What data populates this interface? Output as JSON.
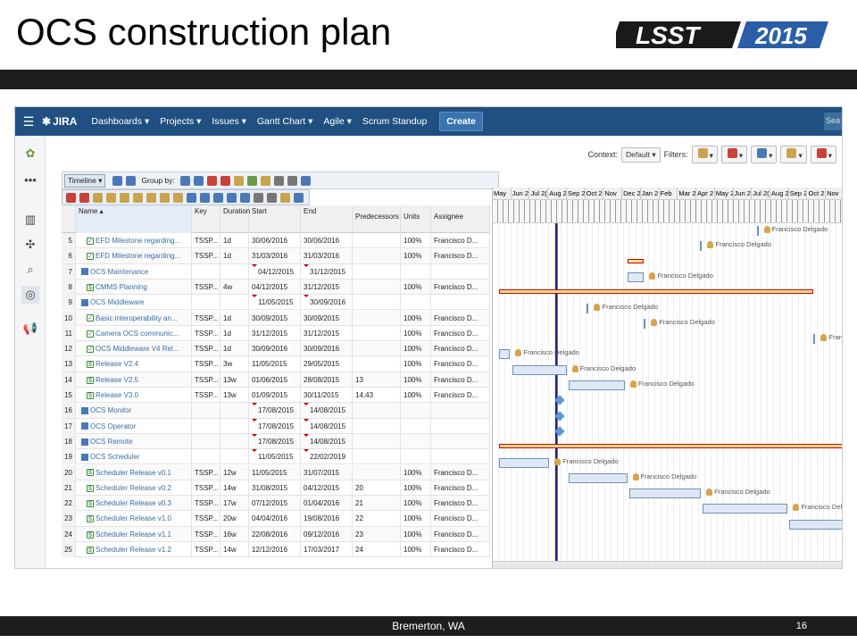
{
  "slide": {
    "title": "OCS construction plan",
    "footer": "Bremerton, WA",
    "page": "16",
    "logo_text": "LSST",
    "logo_year": "2015"
  },
  "nav": {
    "brand": "JIRA",
    "items": [
      "Dashboards ▾",
      "Projects ▾",
      "Issues ▾",
      "Gantt Chart ▾",
      "Agile ▾",
      "Scrum Standup"
    ],
    "create": "Create",
    "search": "Sea"
  },
  "toolbar": {
    "timeline": "Timeline ▾",
    "group_by": "Group by:",
    "context_label": "Context:",
    "context_value": "Default ▾",
    "filters_label": "Filters:"
  },
  "grid": {
    "headers": {
      "name": "Name ▴",
      "key": "Key",
      "duration": "Duration",
      "start": "Start",
      "end": "End",
      "pred": "Predecessors",
      "units": "Units",
      "assignee": "Assignee"
    },
    "rows": [
      {
        "n": "5",
        "name": "EFD Milestone regarding...",
        "key": "TSSP...",
        "dur": "1d",
        "start": "30/06/2016",
        "end": "30/06/2016",
        "pred": "",
        "units": "100%",
        "asg": "Francisco D...",
        "type": "task"
      },
      {
        "n": "6",
        "name": "EFD Milestone regarding...",
        "key": "TSSP...",
        "dur": "1d",
        "start": "31/03/2016",
        "end": "31/03/2016",
        "pred": "",
        "units": "100%",
        "asg": "Francisco D...",
        "type": "task"
      },
      {
        "n": "7",
        "name": "OCS Maintenance",
        "key": "",
        "dur": "",
        "start": "04/12/2015",
        "end": "31/12/2015",
        "pred": "",
        "units": "",
        "asg": "",
        "type": "group"
      },
      {
        "n": "8",
        "name": "CMMS Planning",
        "key": "TSSP...",
        "dur": "4w",
        "start": "04/12/2015",
        "end": "31/12/2015",
        "pred": "",
        "units": "100%",
        "asg": "Francisco D...",
        "type": "dollar"
      },
      {
        "n": "9",
        "name": "OCS Middleware",
        "key": "",
        "dur": "",
        "start": "11/05/2015",
        "end": "30/09/2016",
        "pred": "",
        "units": "",
        "asg": "",
        "type": "group"
      },
      {
        "n": "10",
        "name": "Basic interoperability an...",
        "key": "TSSP...",
        "dur": "1d",
        "start": "30/09/2015",
        "end": "30/09/2015",
        "pred": "",
        "units": "100%",
        "asg": "Francisco D...",
        "type": "task"
      },
      {
        "n": "11",
        "name": "Camera OCS communic...",
        "key": "TSSP...",
        "dur": "1d",
        "start": "31/12/2015",
        "end": "31/12/2015",
        "pred": "",
        "units": "100%",
        "asg": "Francisco D...",
        "type": "task"
      },
      {
        "n": "12",
        "name": "OCS Middleware V4 Rel...",
        "key": "TSSP...",
        "dur": "1d",
        "start": "30/09/2016",
        "end": "30/09/2016",
        "pred": "",
        "units": "100%",
        "asg": "Francisco D...",
        "type": "task"
      },
      {
        "n": "13",
        "name": "Release V2.4",
        "key": "TSSP...",
        "dur": "3w",
        "start": "11/05/2015",
        "end": "29/05/2015",
        "pred": "",
        "units": "100%",
        "asg": "Francisco D...",
        "type": "dollar"
      },
      {
        "n": "14",
        "name": "Release V2.5",
        "key": "TSSP...",
        "dur": "13w",
        "start": "01/06/2015",
        "end": "28/08/2015",
        "pred": "13",
        "units": "100%",
        "asg": "Francisco D...",
        "type": "dollar"
      },
      {
        "n": "15",
        "name": "Release V3.0",
        "key": "TSSP...",
        "dur": "13w",
        "start": "01/09/2015",
        "end": "30/11/2015",
        "pred": "14,43",
        "units": "100%",
        "asg": "Francisco D...",
        "type": "dollar"
      },
      {
        "n": "16",
        "name": "OCS Monitor",
        "key": "",
        "dur": "",
        "start": "17/08/2015",
        "end": "14/08/2015",
        "pred": "",
        "units": "",
        "asg": "",
        "type": "group"
      },
      {
        "n": "17",
        "name": "OCS Operator",
        "key": "",
        "dur": "",
        "start": "17/08/2015",
        "end": "14/08/2015",
        "pred": "",
        "units": "",
        "asg": "",
        "type": "group"
      },
      {
        "n": "18",
        "name": "OCS Remote",
        "key": "",
        "dur": "",
        "start": "17/08/2015",
        "end": "14/08/2015",
        "pred": "",
        "units": "",
        "asg": "",
        "type": "group"
      },
      {
        "n": "19",
        "name": "OCS Scheduler",
        "key": "",
        "dur": "",
        "start": "11/05/2015",
        "end": "22/02/2019",
        "pred": "",
        "units": "",
        "asg": "",
        "type": "group"
      },
      {
        "n": "20",
        "name": "Scheduler Release v0.1",
        "key": "TSSP...",
        "dur": "12w",
        "start": "11/05/2015",
        "end": "31/07/2015",
        "pred": "",
        "units": "100%",
        "asg": "Francisco D...",
        "type": "dollar"
      },
      {
        "n": "21",
        "name": "Scheduler Release v0.2",
        "key": "TSSP...",
        "dur": "14w",
        "start": "31/08/2015",
        "end": "04/12/2015",
        "pred": "20",
        "units": "100%",
        "asg": "Francisco D...",
        "type": "dollar"
      },
      {
        "n": "22",
        "name": "Scheduler Release v0.3",
        "key": "TSSP...",
        "dur": "17w",
        "start": "07/12/2015",
        "end": "01/04/2016",
        "pred": "21",
        "units": "100%",
        "asg": "Francisco D...",
        "type": "dollar"
      },
      {
        "n": "23",
        "name": "Scheduler Release v1.0",
        "key": "TSSP...",
        "dur": "20w",
        "start": "04/04/2016",
        "end": "19/08/2016",
        "pred": "22",
        "units": "100%",
        "asg": "Francisco D...",
        "type": "dollar"
      },
      {
        "n": "24",
        "name": "Scheduler Release v1.1",
        "key": "TSSP...",
        "dur": "16w",
        "start": "22/08/2016",
        "end": "09/12/2016",
        "pred": "23",
        "units": "100%",
        "asg": "Francisco D...",
        "type": "dollar"
      },
      {
        "n": "25",
        "name": "Scheduler Release v1.2",
        "key": "TSSP...",
        "dur": "14w",
        "start": "12/12/2016",
        "end": "17/03/2017",
        "pred": "24",
        "units": "100%",
        "asg": "Francisco D...",
        "type": "dollar"
      }
    ]
  },
  "gantt": {
    "months": [
      "May",
      "Jun 2",
      "Jul 2(",
      "Aug 2",
      "Sep 2",
      "Oct 2",
      "Nov",
      "Dec 2",
      "Jan 2",
      "Feb",
      "Mar 2",
      "Apr 2",
      "May 2",
      "Jun 2",
      "Jul 2(",
      "Aug 2",
      "Sep 2",
      "Oct 2",
      "Nov"
    ],
    "assignee": "Francisco Delgado"
  }
}
